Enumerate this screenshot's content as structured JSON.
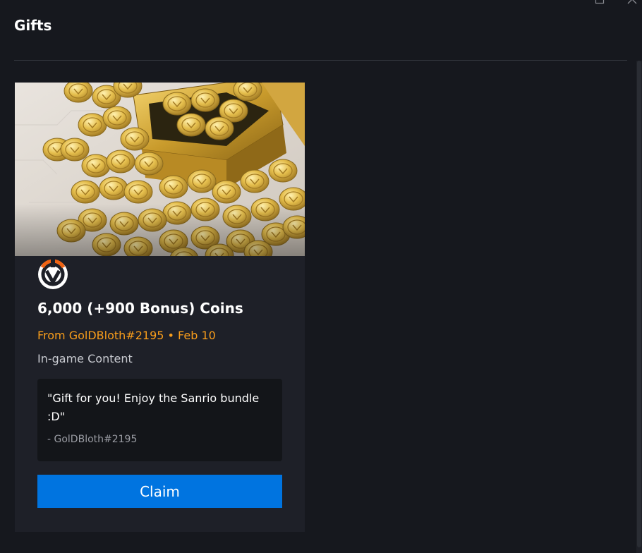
{
  "header": {
    "title": "Gifts",
    "maximize_icon": "maximize-icon",
    "close_icon": "close-icon"
  },
  "gift": {
    "image": "gold-coins-image",
    "game_logo": "overwatch-logo",
    "product_name": "6,000 (+900 Bonus) Coins",
    "from_line": "From GolDBloth#2195 • Feb 10",
    "content_type": "In-game Content",
    "message": "\"Gift for you! Enjoy the Sanrio bundle :D\"",
    "signature": "- GolDBloth#2195",
    "claim_label": "Claim"
  },
  "colors": {
    "background": "#16181e",
    "card": "#1e2028",
    "message_box": "#131519",
    "accent_orange": "#f89d1b",
    "claim_blue": "#0074e0"
  }
}
